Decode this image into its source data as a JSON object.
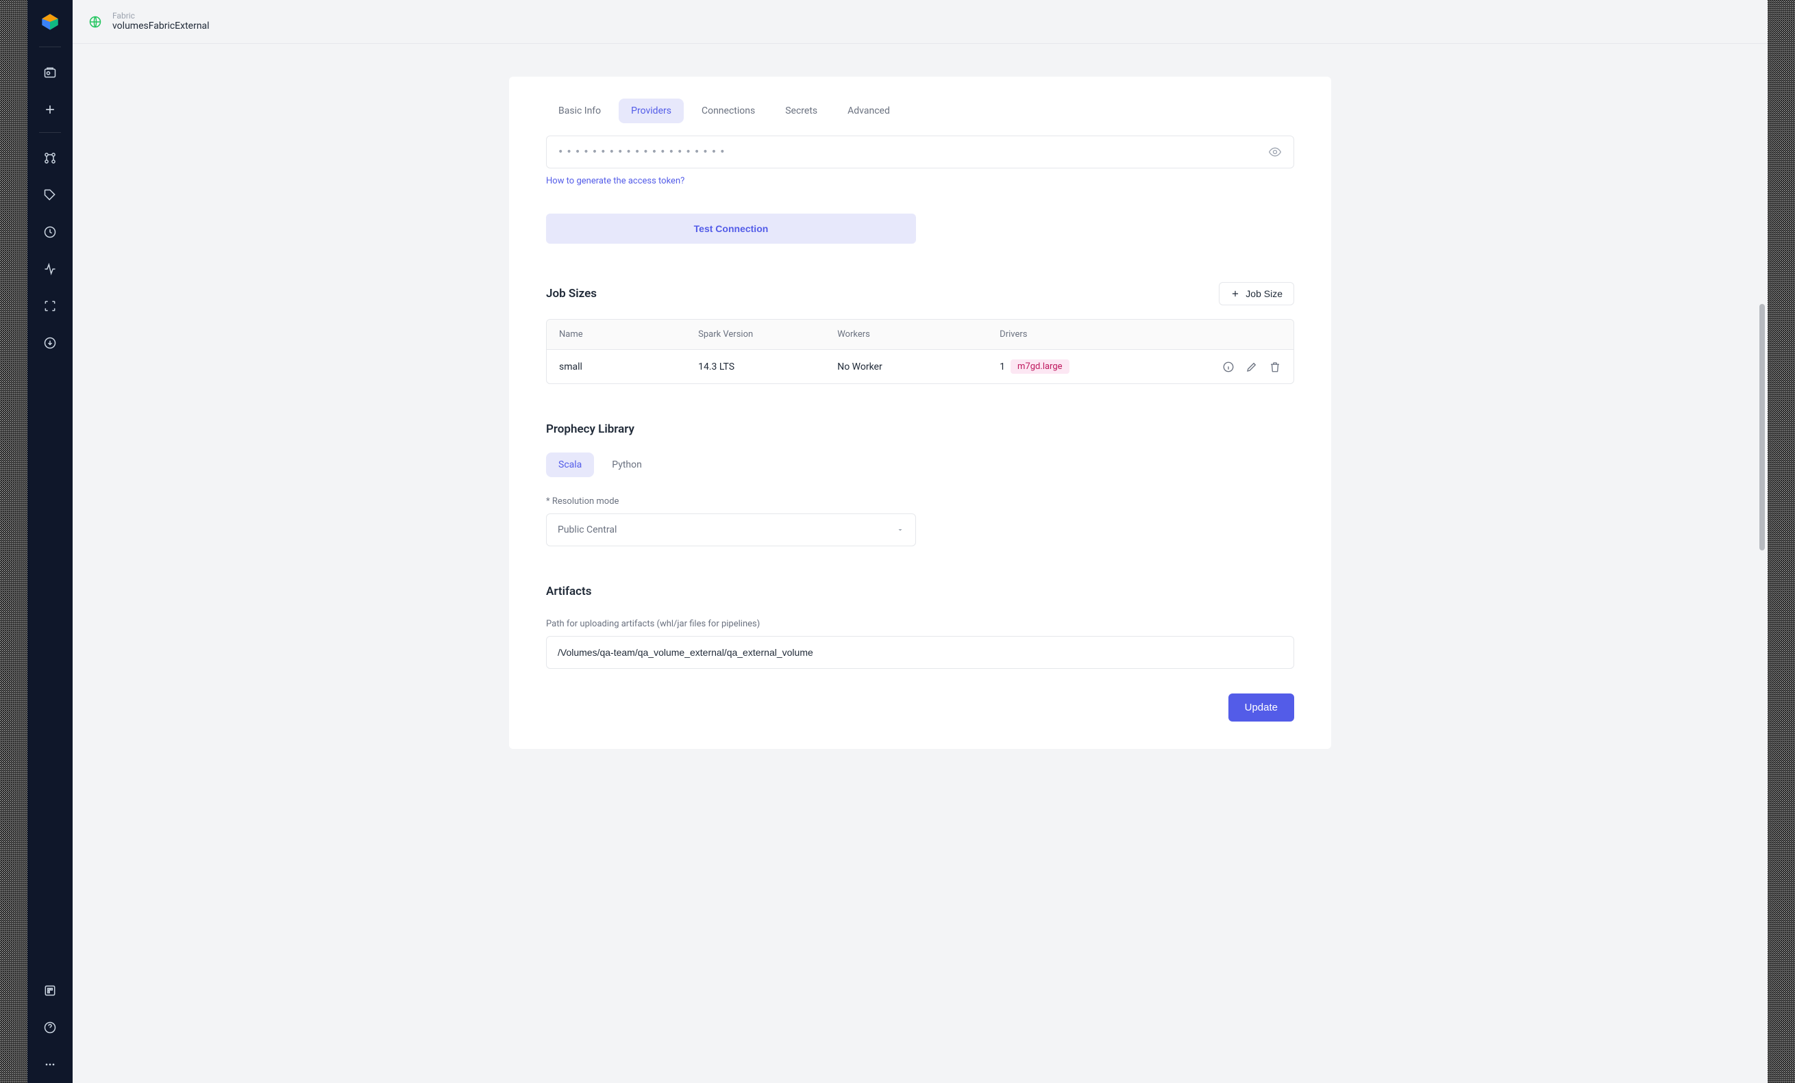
{
  "header": {
    "type_label": "Fabric",
    "title": "volumesFabricExternal"
  },
  "tabs": [
    {
      "label": "Basic Info",
      "active": false
    },
    {
      "label": "Providers",
      "active": true
    },
    {
      "label": "Connections",
      "active": false
    },
    {
      "label": "Secrets",
      "active": false
    },
    {
      "label": "Advanced",
      "active": false
    }
  ],
  "access_token": {
    "masked_value": "••••••••••••••••••••",
    "help_link_text": "How to generate the access token?"
  },
  "test_connection_label": "Test Connection",
  "job_sizes": {
    "title": "Job Sizes",
    "add_button_label": "Job Size",
    "columns": [
      "Name",
      "Spark Version",
      "Workers",
      "Drivers"
    ],
    "rows": [
      {
        "name": "small",
        "spark_version": "14.3 LTS",
        "workers": "No Worker",
        "driver_count": "1",
        "driver_type": "m7gd.large"
      }
    ]
  },
  "prophecy_library": {
    "title": "Prophecy Library",
    "tabs": [
      {
        "label": "Scala",
        "active": true
      },
      {
        "label": "Python",
        "active": false
      }
    ],
    "resolution_mode_label": "* Resolution mode",
    "resolution_mode_value": "Public Central"
  },
  "artifacts": {
    "title": "Artifacts",
    "path_label": "Path for uploading artifacts (whl/jar files for pipelines)",
    "path_value": "/Volumes/qa-team/qa_volume_external/qa_external_volume"
  },
  "update_button_label": "Update"
}
